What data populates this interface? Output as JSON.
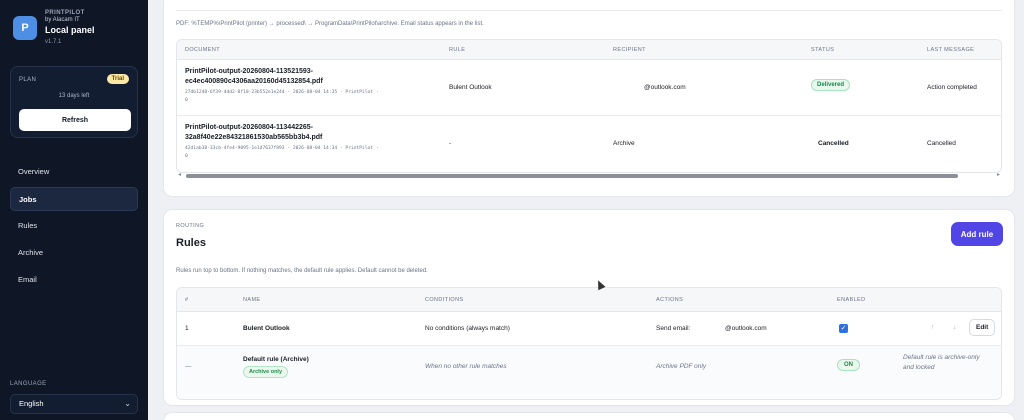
{
  "brand": {
    "name": "PRINTPILOT",
    "by": "by Alacam IT",
    "title": "Local panel",
    "version": "v1.7.1",
    "logo_letter": "P"
  },
  "plan": {
    "label": "PLAN",
    "badge": "Trial",
    "days_left": "13 days left",
    "refresh_label": "Refresh"
  },
  "nav": [
    {
      "label": "Overview",
      "active": false
    },
    {
      "label": "Jobs",
      "active": true
    },
    {
      "label": "Rules",
      "active": false
    },
    {
      "label": "Archive",
      "active": false
    },
    {
      "label": "Email",
      "active": false
    }
  ],
  "language": {
    "label": "LANGUAGE",
    "value": "English"
  },
  "jobs": {
    "pdf_note": "PDF: %TEMP%\\PrintPilot (printer) → processed\\ → ProgramData\\PrintPilot\\archive. Email status appears in the list.",
    "columns": [
      "DOCUMENT",
      "RULE",
      "RECIPIENT",
      "STATUS",
      "LAST MESSAGE"
    ],
    "rows": [
      {
        "doc_line1": "PrintPilot-output-20260804-113521593-",
        "doc_line2": "ec4ec400890c4306aa20160d45132854.pdf",
        "meta_line1": "27db1248-6f39-4dd2-8f10-23b552e1e244 · 2026-08-04 14:35 · PrintPilot ·",
        "meta_line2": "0",
        "rule": "Bulent Outlook",
        "recipient": "@outlook.com",
        "status": "Delivered",
        "last_message": "Action completed"
      },
      {
        "doc_line1": "PrintPilot-output-20260804-113442265-",
        "doc_line2": "32a8f40e22e84321861530ab565bb3b4.pdf",
        "meta_line1": "42d1ab38-33cb-4fe4-9095-1e1d7637f893 · 2026-08-04 14:34 · PrintPilot ·",
        "meta_line2": "0",
        "rule": "-",
        "recipient": "Archive",
        "status": "Cancelled",
        "last_message": "Cancelled"
      }
    ],
    "scroll_left": "◂",
    "scroll_right": "▸"
  },
  "rules": {
    "section_label": "ROUTING",
    "title": "Rules",
    "add_rule_label": "Add rule",
    "note": "Rules run top to bottom. If nothing matches, the default rule applies. Default cannot be deleted.",
    "columns": [
      "#",
      "NAME",
      "CONDITIONS",
      "ACTIONS",
      "ENABLED"
    ],
    "rows": [
      {
        "num": "1",
        "name": "Bulent Outlook",
        "conditions": "No conditions (always match)",
        "action_label": "Send email:",
        "action_value": "@outlook.com",
        "checkmark": "✓",
        "up": "↑",
        "down": "↓",
        "edit_label": "Edit"
      },
      {
        "num": "—",
        "name": "Default rule (Archive)",
        "tag": "Archive only",
        "conditions": "When no other rule matches",
        "action": "Archive PDF only",
        "enabled": "ON",
        "note_line1": "Default rule is archive-only",
        "note_line2": "and locked"
      }
    ]
  }
}
